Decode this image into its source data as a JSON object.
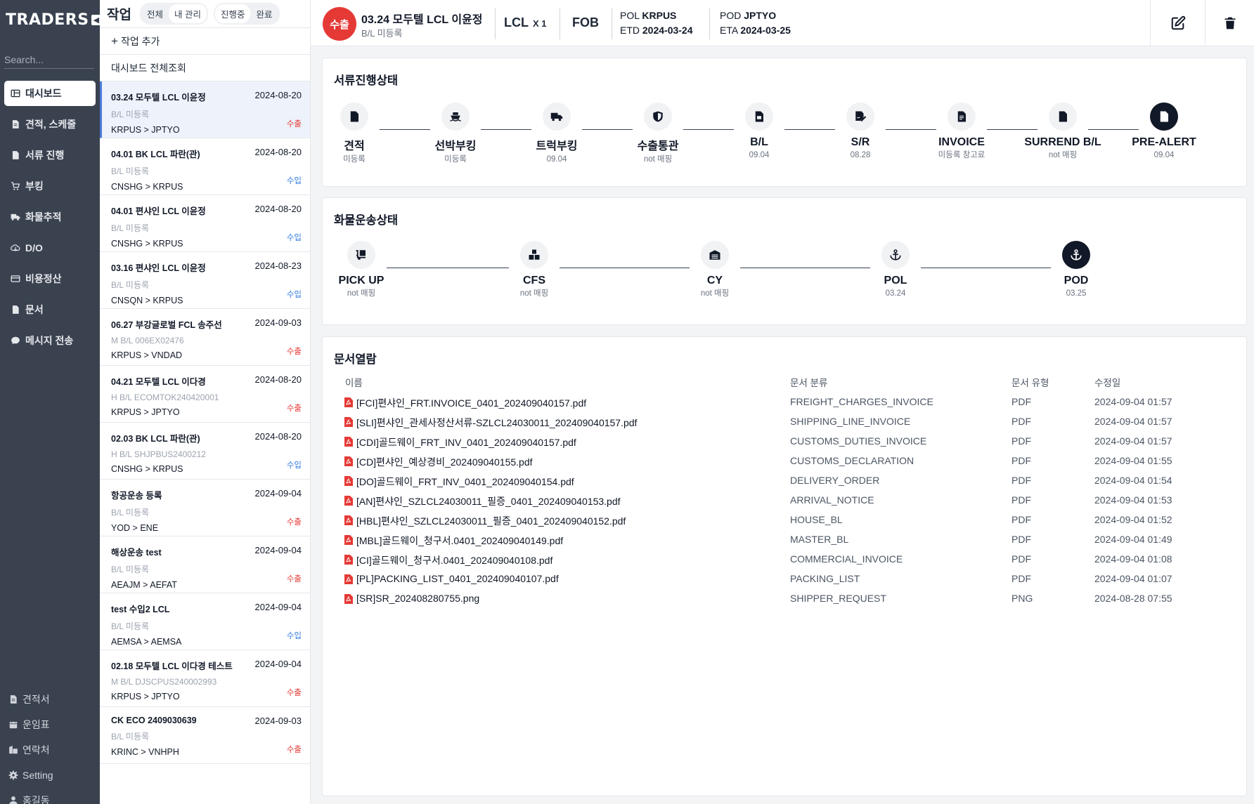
{
  "sidebar": {
    "logo": "TRADERS",
    "logo_mark": "◀",
    "search_placeholder": "Search...",
    "items": [
      {
        "label": "대시보드",
        "icon": "dashboard-icon"
      },
      {
        "label": "견적, 스케줄",
        "icon": "document-icon"
      },
      {
        "label": "서류 진행",
        "icon": "file-icon"
      },
      {
        "label": "부킹",
        "icon": "cart-icon"
      },
      {
        "label": "화물추적",
        "icon": "truck-icon"
      },
      {
        "label": "D/O",
        "icon": "cloud-icon"
      },
      {
        "label": "비용정산",
        "icon": "card-icon"
      },
      {
        "label": "문서",
        "icon": "file-icon"
      },
      {
        "label": "메시지 전송",
        "icon": "chat-icon"
      }
    ],
    "bottom_items": [
      {
        "label": "견적서",
        "icon": "document-icon"
      },
      {
        "label": "운임표",
        "icon": "calendar-icon"
      },
      {
        "label": "연락처",
        "icon": "building-icon"
      },
      {
        "label": "Setting",
        "icon": "gear-icon"
      },
      {
        "label": "홍길동",
        "icon": "user-icon"
      }
    ]
  },
  "joblist": {
    "title": "작업",
    "filter_scope": [
      "전체",
      "내 관리"
    ],
    "filter_status": [
      "진행중",
      "완료"
    ],
    "add_label": "작업 추가",
    "add_plus": "+",
    "view_all_label": "대시보드 전체조회",
    "jobs": [
      {
        "title": "03.24 모두텔 LCL 이윤정",
        "date": "2024-08-20",
        "bl": "B/L 미등록",
        "route": "KRPUS > JPTYO",
        "type": "수출"
      },
      {
        "title": "04.01 BK LCL 파란(관)",
        "date": "2024-08-20",
        "bl": "B/L 미등록",
        "route": "CNSHG > KRPUS",
        "type": "수입"
      },
      {
        "title": "04.01 편샤인 LCL 이윤정",
        "date": "2024-08-20",
        "bl": "B/L 미등록",
        "route": "CNSHG > KRPUS",
        "type": "수입"
      },
      {
        "title": "03.16 편샤인 LCL 이윤정",
        "date": "2024-08-23",
        "bl": "B/L 미등록",
        "route": "CNSQN > KRPUS",
        "type": "수입"
      },
      {
        "title": "06.27 부강글로벌 FCL 송주선",
        "date": "2024-09-03",
        "bl": "M B/L 006EX02476",
        "route": "KRPUS > VNDAD",
        "type": "수출"
      },
      {
        "title": "04.21 모두텔 LCL 이다경",
        "date": "2024-08-20",
        "bl": "H B/L ECOMTOK240420001",
        "route": "KRPUS > JPTYO",
        "type": "수출"
      },
      {
        "title": "02.03 BK LCL 파란(관)",
        "date": "2024-08-20",
        "bl": "H B/L SHJPBUS2400212",
        "route": "CNSHG > KRPUS",
        "type": "수입"
      },
      {
        "title": "항공운송 등록",
        "date": "2024-09-04",
        "bl": "B/L 미등록",
        "route": "YOD > ENE",
        "type": "수출"
      },
      {
        "title": "해상운송 test",
        "date": "2024-09-04",
        "bl": "B/L 미등록",
        "route": "AEAJM > AEFAT",
        "type": "수출"
      },
      {
        "title": "test 수입2 LCL",
        "date": "2024-09-04",
        "bl": "B/L 미등록",
        "route": "AEMSA > AEMSA",
        "type": "수입"
      },
      {
        "title": "02.18 모두텔 LCL 이다경 테스트",
        "date": "2024-09-04",
        "bl": "M B/L DJSCPUS240002993",
        "route": "KRPUS > JPTYO",
        "type": "수출"
      },
      {
        "title": "CK ECO 2409030639",
        "date": "2024-09-03",
        "bl": "B/L 미등록",
        "route": "KRINC > VNHPH",
        "type": "수출"
      }
    ]
  },
  "header": {
    "badge": "수출",
    "title": "03.24 모두텔 LCL 이윤정",
    "bl": "B/L 미등록",
    "mode": "LCL",
    "mode_qty": "X 1",
    "incoterm": "FOB",
    "pol_label": "POL",
    "pol": "KRPUS",
    "etd_label": "ETD",
    "etd": "2024-03-24",
    "pod_label": "POD",
    "pod": "JPTYO",
    "eta_label": "ETA",
    "eta": "2024-03-25"
  },
  "doc_status": {
    "title": "서류진행상태",
    "steps": [
      {
        "label": "견적",
        "sub": "미등록",
        "icon": "file-icon",
        "active": false
      },
      {
        "label": "선박부킹",
        "sub": "미등록",
        "icon": "ship-icon",
        "active": false
      },
      {
        "label": "트럭부킹",
        "sub": "09.04",
        "icon": "truck-icon",
        "active": false
      },
      {
        "label": "수출통관",
        "sub": "not 매핑",
        "icon": "shield-icon",
        "active": false
      },
      {
        "label": "B/L",
        "sub": "09.04",
        "icon": "bl-doc-icon",
        "active": false
      },
      {
        "label": "S/R",
        "sub": "08.28",
        "icon": "signature-icon",
        "active": false
      },
      {
        "label": "INVOICE",
        "sub": "미등록 창고료",
        "icon": "invoice-icon",
        "active": false
      },
      {
        "label": "SURREND B/L",
        "sub": "not 매핑",
        "icon": "file-icon",
        "active": false
      },
      {
        "label": "PRE-ALERT",
        "sub": "09.04",
        "icon": "file-icon",
        "active": true
      }
    ]
  },
  "cargo_status": {
    "title": "화물운송상태",
    "steps": [
      {
        "label": "PICK UP",
        "sub": "not 매핑",
        "icon": "truck-ramp-icon",
        "active": false
      },
      {
        "label": "CFS",
        "sub": "not 매핑",
        "icon": "boxes-icon",
        "active": false
      },
      {
        "label": "CY",
        "sub": "not 매핑",
        "icon": "warehouse-icon",
        "active": false
      },
      {
        "label": "POL",
        "sub": "03.24",
        "icon": "anchor-icon",
        "active": false
      },
      {
        "label": "POD",
        "sub": "03.25",
        "icon": "anchor-icon",
        "active": true
      }
    ]
  },
  "documents": {
    "title": "문서열람",
    "columns": [
      "이름",
      "문서 분류",
      "문서 유형",
      "수정일"
    ],
    "rows": [
      {
        "name": "[FCI]편샤인_FRT.INVOICE_0401_202409040157.pdf",
        "category": "FREIGHT_CHARGES_INVOICE",
        "type": "PDF",
        "modified": "2024-09-04 01:57"
      },
      {
        "name": "[SLI]편샤인_관세사정산서류-SZLCL24030011_202409040157.pdf",
        "category": "SHIPPING_LINE_INVOICE",
        "type": "PDF",
        "modified": "2024-09-04 01:57"
      },
      {
        "name": "[CDI]골드웨이_FRT_INV_0401_202409040157.pdf",
        "category": "CUSTOMS_DUTIES_INVOICE",
        "type": "PDF",
        "modified": "2024-09-04 01:57"
      },
      {
        "name": "[CD]편샤인_예상경비_202409040155.pdf",
        "category": "CUSTOMS_DECLARATION",
        "type": "PDF",
        "modified": "2024-09-04 01:55"
      },
      {
        "name": "[DO]골드웨이_FRT_INV_0401_202409040154.pdf",
        "category": "DELIVERY_ORDER",
        "type": "PDF",
        "modified": "2024-09-04 01:54"
      },
      {
        "name": "[AN]편샤인_SZLCL24030011_필증_0401_202409040153.pdf",
        "category": "ARRIVAL_NOTICE",
        "type": "PDF",
        "modified": "2024-09-04 01:53"
      },
      {
        "name": "[HBL]편샤인_SZLCL24030011_필증_0401_202409040152.pdf",
        "category": "HOUSE_BL",
        "type": "PDF",
        "modified": "2024-09-04 01:52"
      },
      {
        "name": "[MBL]골드웨이_청구서.0401_202409040149.pdf",
        "category": "MASTER_BL",
        "type": "PDF",
        "modified": "2024-09-04 01:49"
      },
      {
        "name": "[CI]골드웨이_청구서.0401_202409040108.pdf",
        "category": "COMMERCIAL_INVOICE",
        "type": "PDF",
        "modified": "2024-09-04 01:08"
      },
      {
        "name": "[PL]PACKING_LIST_0401_202409040107.pdf",
        "category": "PACKING_LIST",
        "type": "PDF",
        "modified": "2024-09-04 01:07"
      },
      {
        "name": "[SR]SR_202408280755.png",
        "category": "SHIPPER_REQUEST",
        "type": "PNG",
        "modified": "2024-08-28 07:55"
      }
    ]
  },
  "colors": {
    "sidebar_bg": "#3a4250",
    "export_red": "#e53935",
    "import_blue": "#2f7be0",
    "active_step": "#111827",
    "selected_row_bg": "#eef2fb"
  }
}
